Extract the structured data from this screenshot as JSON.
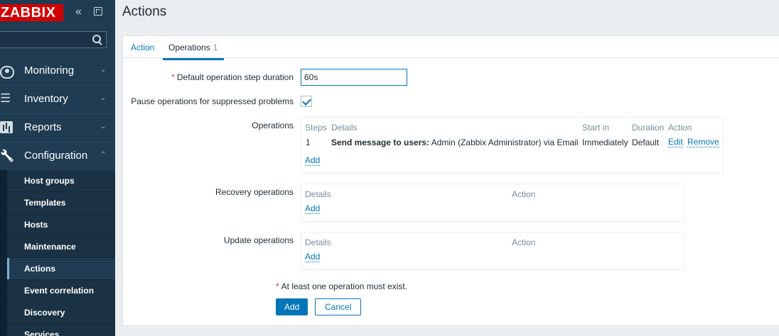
{
  "sidebar": {
    "logo": "ZABBIX",
    "collapse_glyph": "«",
    "menu": [
      {
        "label": "Monitoring",
        "icon": "eye-icon"
      },
      {
        "label": "Inventory",
        "icon": "list-icon"
      },
      {
        "label": "Reports",
        "icon": "bar-chart-icon"
      },
      {
        "label": "Configuration",
        "icon": "wrench-icon"
      }
    ],
    "chevron_down": "⌄",
    "chevron_up": "⌃",
    "submenu": [
      "Host groups",
      "Templates",
      "Hosts",
      "Maintenance",
      "Actions",
      "Event correlation",
      "Discovery",
      "Services"
    ]
  },
  "page": {
    "title": "Actions"
  },
  "tabs": [
    {
      "label": "Action"
    },
    {
      "label": "Operations",
      "count": "1"
    }
  ],
  "form": {
    "step_duration_label": "Default operation step duration",
    "step_duration_value": "60s",
    "pause_label": "Pause operations for suppressed problems",
    "pause_checked": true,
    "operations_label": "Operations",
    "operations_headers": [
      "Steps",
      "Details",
      "Start in",
      "Duration",
      "Action"
    ],
    "operations_rows": [
      {
        "step": "1",
        "details_bold": "Send message to users:",
        "details_rest": " Admin (Zabbix Administrator) via Email",
        "start_in": "Immediately",
        "duration": "Default",
        "actions": [
          "Edit",
          "Remove"
        ]
      }
    ],
    "add_link": "Add",
    "recovery_label": "Recovery operations",
    "update_label": "Update operations",
    "sub_headers": [
      "Details",
      "Action"
    ],
    "warning": "At least one operation must exist.",
    "add_button": "Add",
    "cancel_button": "Cancel"
  },
  "colors": {
    "accent": "#0275b8",
    "sidebar": "#1f3c52",
    "logo": "#d40000",
    "required": "#e33734"
  }
}
